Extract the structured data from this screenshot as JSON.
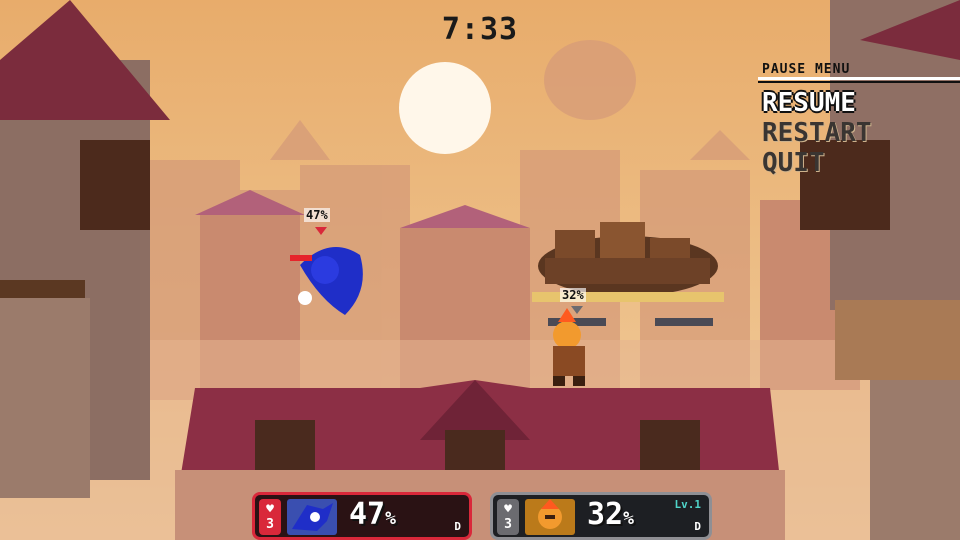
{
  "match": {
    "timer": "7:33"
  },
  "pause_menu": {
    "title": "PAUSE MENU",
    "items": [
      {
        "label": "RESUME",
        "state": "selected"
      },
      {
        "label": "RESTART",
        "state": "unselected"
      },
      {
        "label": "QUIT",
        "state": "unselected"
      }
    ]
  },
  "fighters": {
    "p1_overhead_damage": "47%",
    "p2_overhead_damage": "32%"
  },
  "hud": {
    "p1": {
      "stocks": "3",
      "damage": "47",
      "damage_unit": "%",
      "tag": "D",
      "border_color": "#d9283a",
      "stock_icon": "heart-icon"
    },
    "p2": {
      "stocks": "3",
      "damage": "32",
      "damage_unit": "%",
      "tag": "D",
      "level": "Lv.1",
      "border_color": "#8f8f94",
      "stock_icon": "heart-icon"
    }
  },
  "colors": {
    "sky": "#e9b97c",
    "sun": "#fff7ea",
    "roof": "#8c2f45",
    "p1": "#d9283a",
    "p2": "#8f8f94",
    "accent_level": "#4fd4c9"
  }
}
